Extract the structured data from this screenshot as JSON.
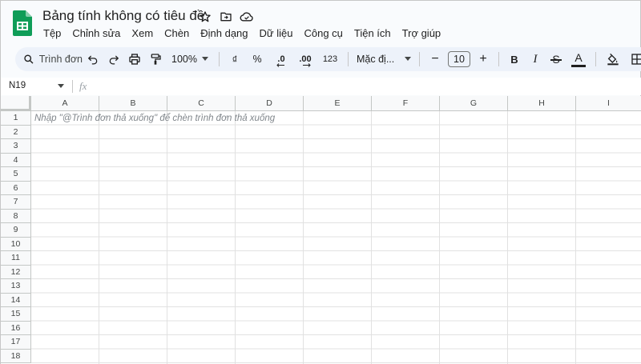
{
  "doc": {
    "title": "Bảng tính không có tiêu đề",
    "brand_color": "#0f9d58"
  },
  "menu": [
    "Tệp",
    "Chỉnh sửa",
    "Xem",
    "Chèn",
    "Định dạng",
    "Dữ liệu",
    "Công cụ",
    "Tiện ích",
    "Trợ giúp"
  ],
  "toolbar": {
    "search_label": "Trình đơn",
    "zoom": "100%",
    "currency": "₫",
    "percent": "%",
    "decrease_decimal": ".0",
    "increase_decimal": ".00",
    "number_format": "123",
    "font": "Mặc đị...",
    "minus": "−",
    "font_size": "10",
    "plus": "+",
    "bold": "B",
    "italic": "I",
    "strike": "S",
    "text_color": "A"
  },
  "formula_bar": {
    "name_box": "N19",
    "fx": "fx"
  },
  "grid": {
    "columns": [
      "A",
      "B",
      "C",
      "D",
      "E",
      "F",
      "G",
      "H",
      "I"
    ],
    "rows": [
      "1",
      "2",
      "3",
      "4",
      "5",
      "6",
      "7",
      "8",
      "9",
      "10",
      "11",
      "12",
      "13",
      "14",
      "15",
      "16",
      "17",
      "18"
    ],
    "hint": "Nhập \"@Trình đơn thả xuống\" để chèn trình đơn thả xuống"
  }
}
